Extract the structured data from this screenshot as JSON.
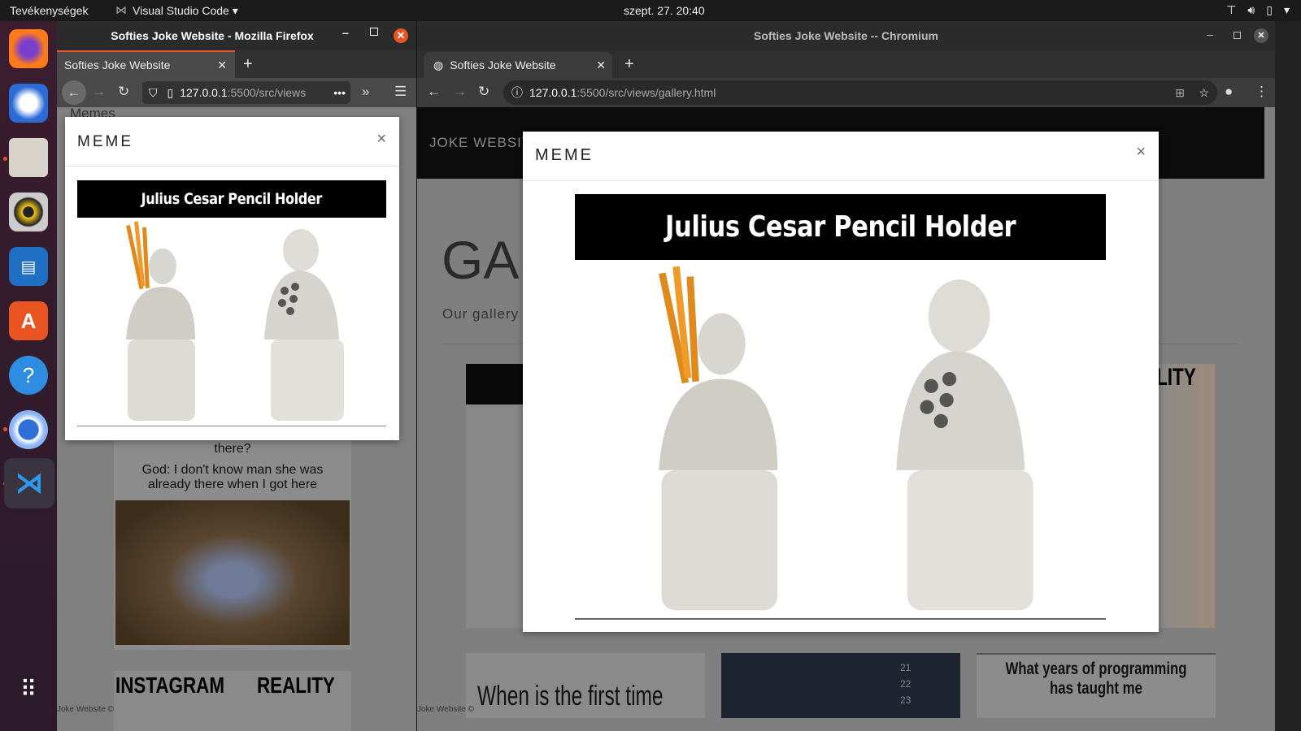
{
  "topbar": {
    "activities": "Tevékenységek",
    "app": "Visual Studio Code",
    "clock": "szept. 27.  20:40",
    "tray": [
      "network-icon",
      "volume-icon",
      "battery-icon",
      "menu-arrow-icon"
    ]
  },
  "dock": {
    "apps": [
      "firefox",
      "thunderbird",
      "files",
      "rhythmbox",
      "libreoffice-writer",
      "software",
      "help",
      "chromium",
      "vscode"
    ],
    "show_apps": "show-apps-icon"
  },
  "firefox": {
    "window_title": "Softies Joke Website - Mozilla Firefox",
    "tab_label": "Softies Joke Website",
    "url_host": "127.0.0.1",
    "url_rest": ":5500/src/views",
    "page_heading": "Memes",
    "modal": {
      "title": "MEME",
      "close": "×",
      "image_caption": "Julius Cesar Pencil Holder"
    },
    "bg_memes": {
      "line1": "there?",
      "line2": "God: I don't know man she was",
      "line3": "already there when I got here",
      "left_label": "INSTAGRAM",
      "right_label": "REALITY"
    },
    "footer": "Joke Website ©"
  },
  "chromium": {
    "window_title": "Softies Joke Website -- Chromium",
    "tab_label": "Softies Joke Website",
    "url_host": "127.0.0.1",
    "url_rest": ":5500/src/views/gallery.html",
    "brand": "JOKE WEBSIT",
    "heading": "GA",
    "subheading": "Our gallery",
    "modal": {
      "title": "MEME",
      "close": "×",
      "image_caption": "Julius Cesar Pencil Holder"
    },
    "bg_memes": {
      "reality": "LITY",
      "first_time": "When is the first time",
      "programming_1": "What years of programming",
      "programming_2": "has taught me",
      "numbers": [
        "21",
        "22",
        "23"
      ]
    },
    "footer": "Joke Website ©"
  }
}
